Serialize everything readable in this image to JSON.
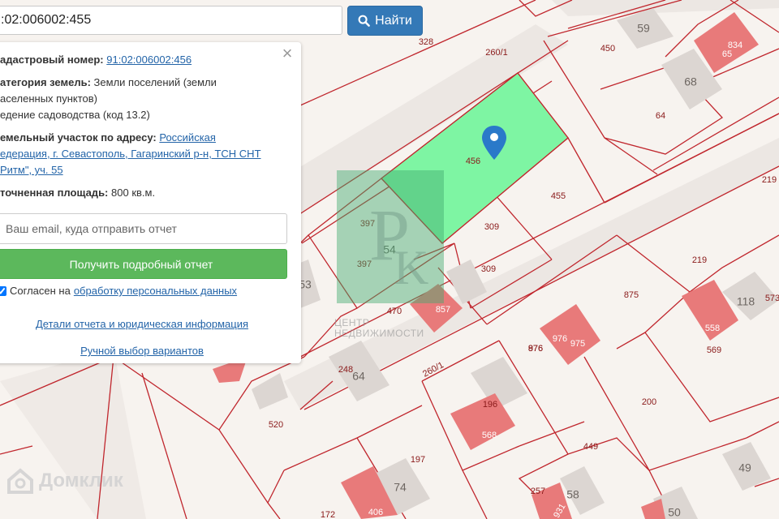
{
  "search": {
    "value": ":02:006002:455",
    "button_label": "Найти"
  },
  "info": {
    "cadastral_label": "адастровый номер:",
    "cadastral_value": "91:02:006002:456",
    "category_label": "атегория земель:",
    "category_value_1": "Земли поселений (земли",
    "category_value_2": "аселенных пунктов)",
    "category_value_3": "едение садоводства (код 13.2)",
    "address_label": "емельный участок по адресу:",
    "address_link_1": "Российская",
    "address_link_2": "едерация, г. Севастополь, Гагаринский р-н, ТСН СНТ",
    "address_link_3": "Ритм\", уч. 55",
    "area_label": "точненная площадь:",
    "area_value": "800 кв.м.",
    "email_placeholder": "Ваш email, куда отправить отчет",
    "report_button": "Получить подробный отчет",
    "consent_text": "Согласен на",
    "consent_link": "обработку персональных данных",
    "details_link": "Детали отчета и юридическая информация",
    "manual_link": "Ручной выбор вариантов"
  },
  "map": {
    "parcel_labels": [
      "328",
      "260/1",
      "450",
      "59",
      "834",
      "65",
      "68",
      "64",
      "219",
      "456",
      "455",
      "397",
      "397",
      "54",
      "309",
      "309",
      "53",
      "470",
      "857",
      "875",
      "219",
      "118",
      "573",
      "558",
      "569",
      "976",
      "975",
      "976",
      "248",
      "64",
      "260/1",
      "876",
      "200",
      "196",
      "568",
      "520",
      "449",
      "197",
      "74",
      "49",
      "257",
      "58",
      "931",
      "172",
      "406",
      "50"
    ],
    "highlight_color": "#7ef5a3",
    "boundary_color": "#c0262d",
    "building_red": "#e87a7a",
    "building_gray": "#dcd6d2"
  },
  "watermark": {
    "line1": "ЦЕНТР",
    "line2": "НЕДВИЖИМОСТИ",
    "brand": "Домклик"
  }
}
